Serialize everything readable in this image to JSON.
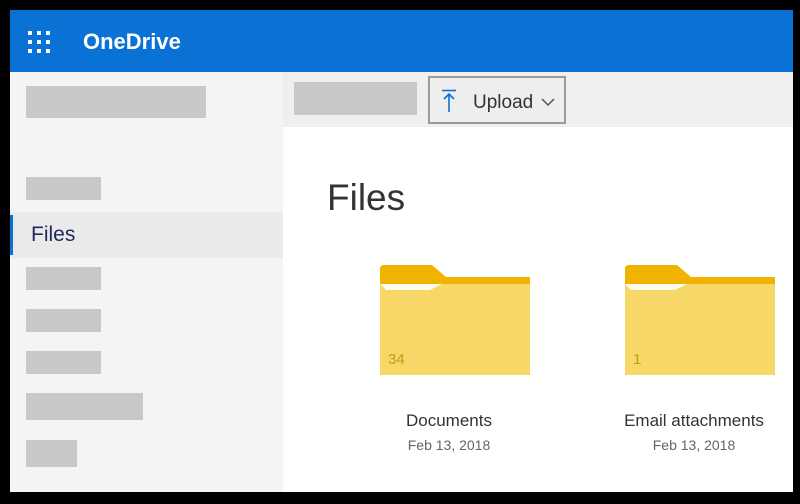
{
  "app": {
    "title": "OneDrive"
  },
  "icons": {
    "app_launcher": "waffle-grid-icon",
    "upload": "upload-arrow-icon",
    "dropdown": "chevron-down-icon",
    "folder": "folder-icon"
  },
  "colors": {
    "brand": "#0a72d4",
    "folder": "#f7d768",
    "folder_dark": "#f0b400"
  },
  "sidebar": {
    "selected_item": "Files"
  },
  "toolbar": {
    "upload_label": "Upload"
  },
  "main": {
    "title": "Files",
    "folders": [
      {
        "name": "Documents",
        "date": "Feb 13, 2018",
        "count": "34"
      },
      {
        "name": "Email attachments",
        "date": "Feb 13, 2018",
        "count": "1"
      }
    ]
  }
}
